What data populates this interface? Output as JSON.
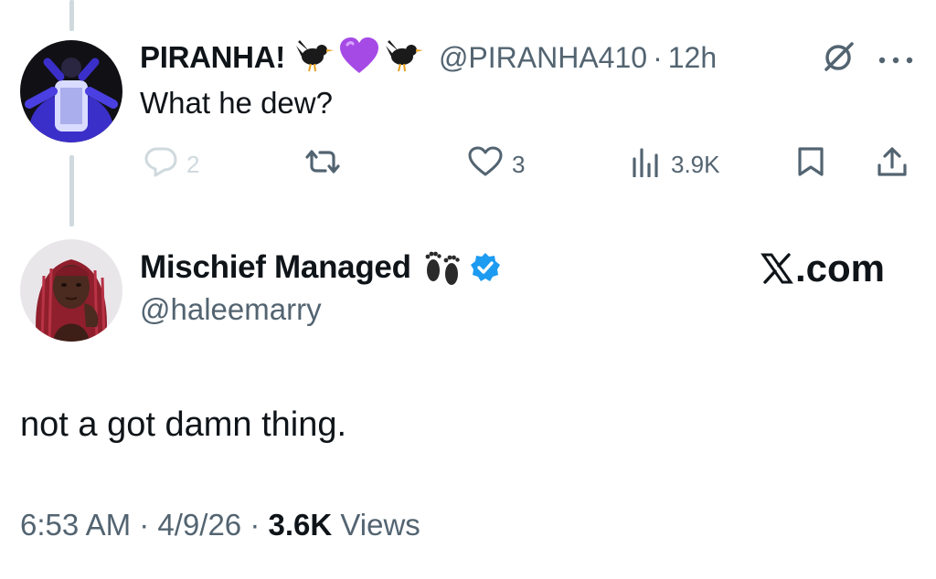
{
  "parent_tweet": {
    "display_name": "PIRANHA!",
    "emoji_icons": [
      "blackbird-emoji-icon",
      "purple-heart-emoji-icon",
      "blackbird-emoji-icon"
    ],
    "handle": "@PIRANHA410",
    "separator": "·",
    "time": "12h",
    "text": "What he dew?",
    "actions": {
      "reply_count": "2",
      "repost_count": "",
      "like_count": "3",
      "views_count": "3.9K"
    }
  },
  "reply_tweet": {
    "display_name": "Mischief Managed",
    "emoji_icon": "footprints-emoji-icon",
    "verified": true,
    "handle": "@haleemarry",
    "watermark": ".com",
    "text": "not a got damn thing.",
    "meta": {
      "time": "6:53 AM",
      "sep1": " · ",
      "date": "4/9/26",
      "sep2": " · ",
      "views_count": "3.6K",
      "views_label": " Views"
    }
  },
  "colors": {
    "text_primary": "#0f1419",
    "text_secondary": "#536471",
    "thread_line": "#cfd9de",
    "verified_blue": "#1d9bf0",
    "purple_heart": "#a64ae6"
  }
}
